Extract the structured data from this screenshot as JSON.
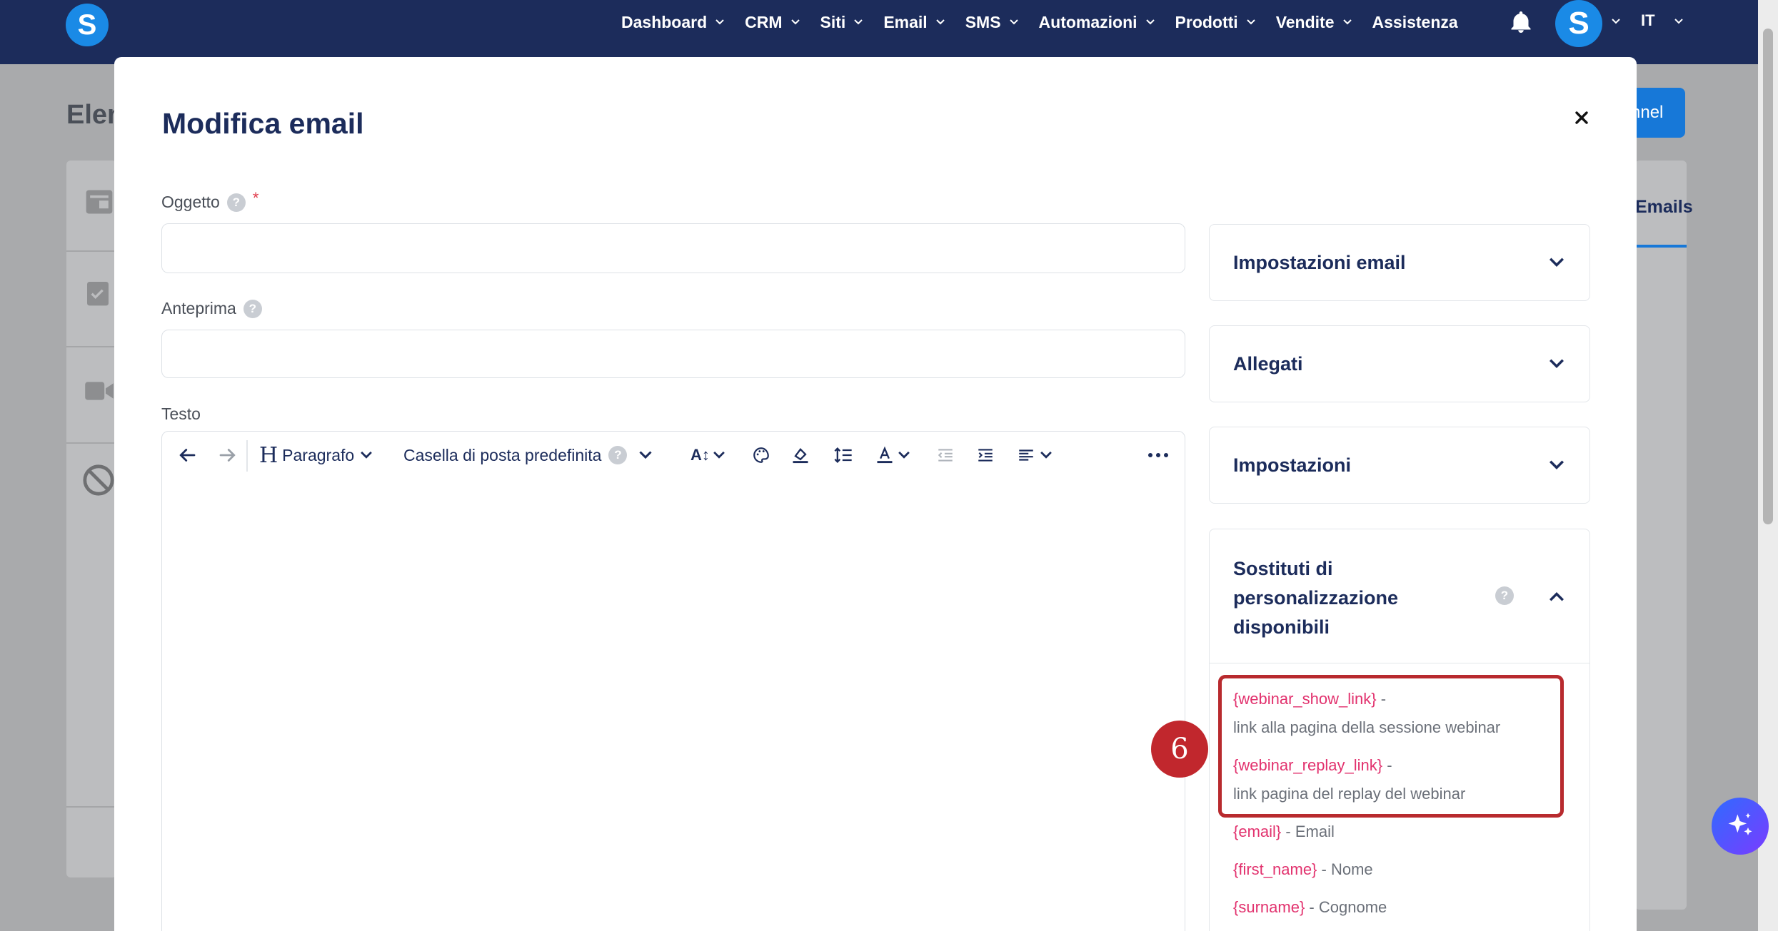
{
  "app": {
    "logo_letter": "S",
    "nav": [
      {
        "label": "Dashboard",
        "has_menu": true
      },
      {
        "label": "CRM",
        "has_menu": true
      },
      {
        "label": "Siti",
        "has_menu": true
      },
      {
        "label": "Email",
        "has_menu": true
      },
      {
        "label": "SMS",
        "has_menu": true
      },
      {
        "label": "Automazioni",
        "has_menu": true
      },
      {
        "label": "Prodotti",
        "has_menu": true
      },
      {
        "label": "Vendite",
        "has_menu": true
      },
      {
        "label": "Assistenza",
        "has_menu": false
      }
    ],
    "avatar_letter": "S",
    "language": "IT"
  },
  "background": {
    "page_title": "Elen",
    "button_label": "nnel",
    "tab_label": "Emails"
  },
  "modal": {
    "title": "Modifica email",
    "fields": {
      "subject": {
        "label": "Oggetto",
        "required_mark": "*",
        "value": ""
      },
      "preview": {
        "label": "Anteprima",
        "value": ""
      },
      "body": {
        "label": "Testo"
      }
    },
    "toolbar": {
      "paragraph_label": "Paragrafo",
      "mailbox_label": "Casella di posta predefinita"
    },
    "help_glyph": "?",
    "cards": {
      "email_settings": "Impostazioni email",
      "attachments": "Allegati",
      "settings": "Impostazioni",
      "substitutes_title": "Sostituti di personalizzazione disponibili"
    },
    "substitutes": [
      {
        "token": "{webinar_show_link}",
        "sep": " -",
        "desc": "link alla pagina della sessione webinar"
      },
      {
        "token": "{webinar_replay_link}",
        "sep": " -",
        "desc": "link pagina del replay del webinar"
      },
      {
        "token": "{email}",
        "sep": " - ",
        "desc": "Email"
      },
      {
        "token": "{first_name}",
        "sep": " - ",
        "desc": "Nome"
      },
      {
        "token": "{surname}",
        "sep": " - ",
        "desc": "Cognome"
      }
    ]
  },
  "annotation": {
    "step_number": "6"
  },
  "colors": {
    "nav_bg": "#1c2c5b",
    "brand_blue": "#1a8ae6",
    "token_pink": "#e2326e",
    "highlight_red": "#b82a2e"
  }
}
